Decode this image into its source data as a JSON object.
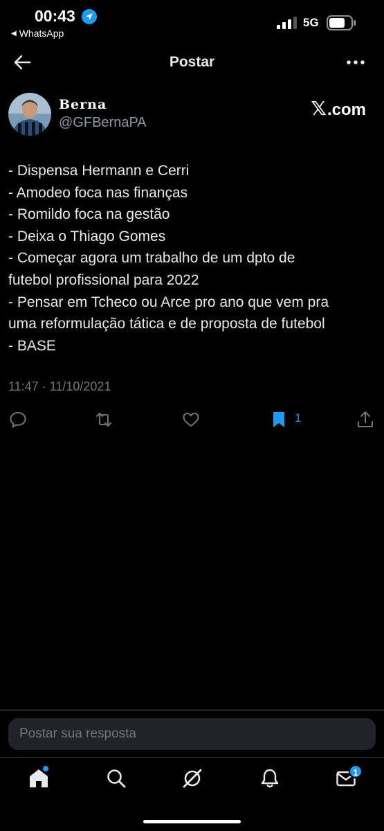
{
  "status_bar": {
    "time": "00:43",
    "back_app": "WhatsApp",
    "network": "5G"
  },
  "header": {
    "title": "Postar"
  },
  "post": {
    "display_name": "Berna",
    "handle": "@GFBernaPA",
    "brand": ".com",
    "lines": [
      "- Dispensa Hermann e Cerri",
      "- Amodeo foca nas finanças",
      "- Romildo foca na gestão",
      "- Deixa o Thiago Gomes",
      "- Começar agora um trabalho de um dpto de",
      "futebol profissional para 2022",
      "- Pensar em Tcheco ou Arce pro ano que vem pra",
      "uma reformulação tática e de proposta de futebol",
      "- BASE"
    ],
    "timestamp": "11:47 · 11/10/2021",
    "bookmark_count": "1"
  },
  "reply": {
    "placeholder": "Postar sua resposta"
  },
  "tabs": {
    "messages_badge": "1"
  },
  "colors": {
    "accent": "#1d9bf0",
    "background": "#000000",
    "text": "#e7e9ea",
    "muted": "#71767b"
  }
}
